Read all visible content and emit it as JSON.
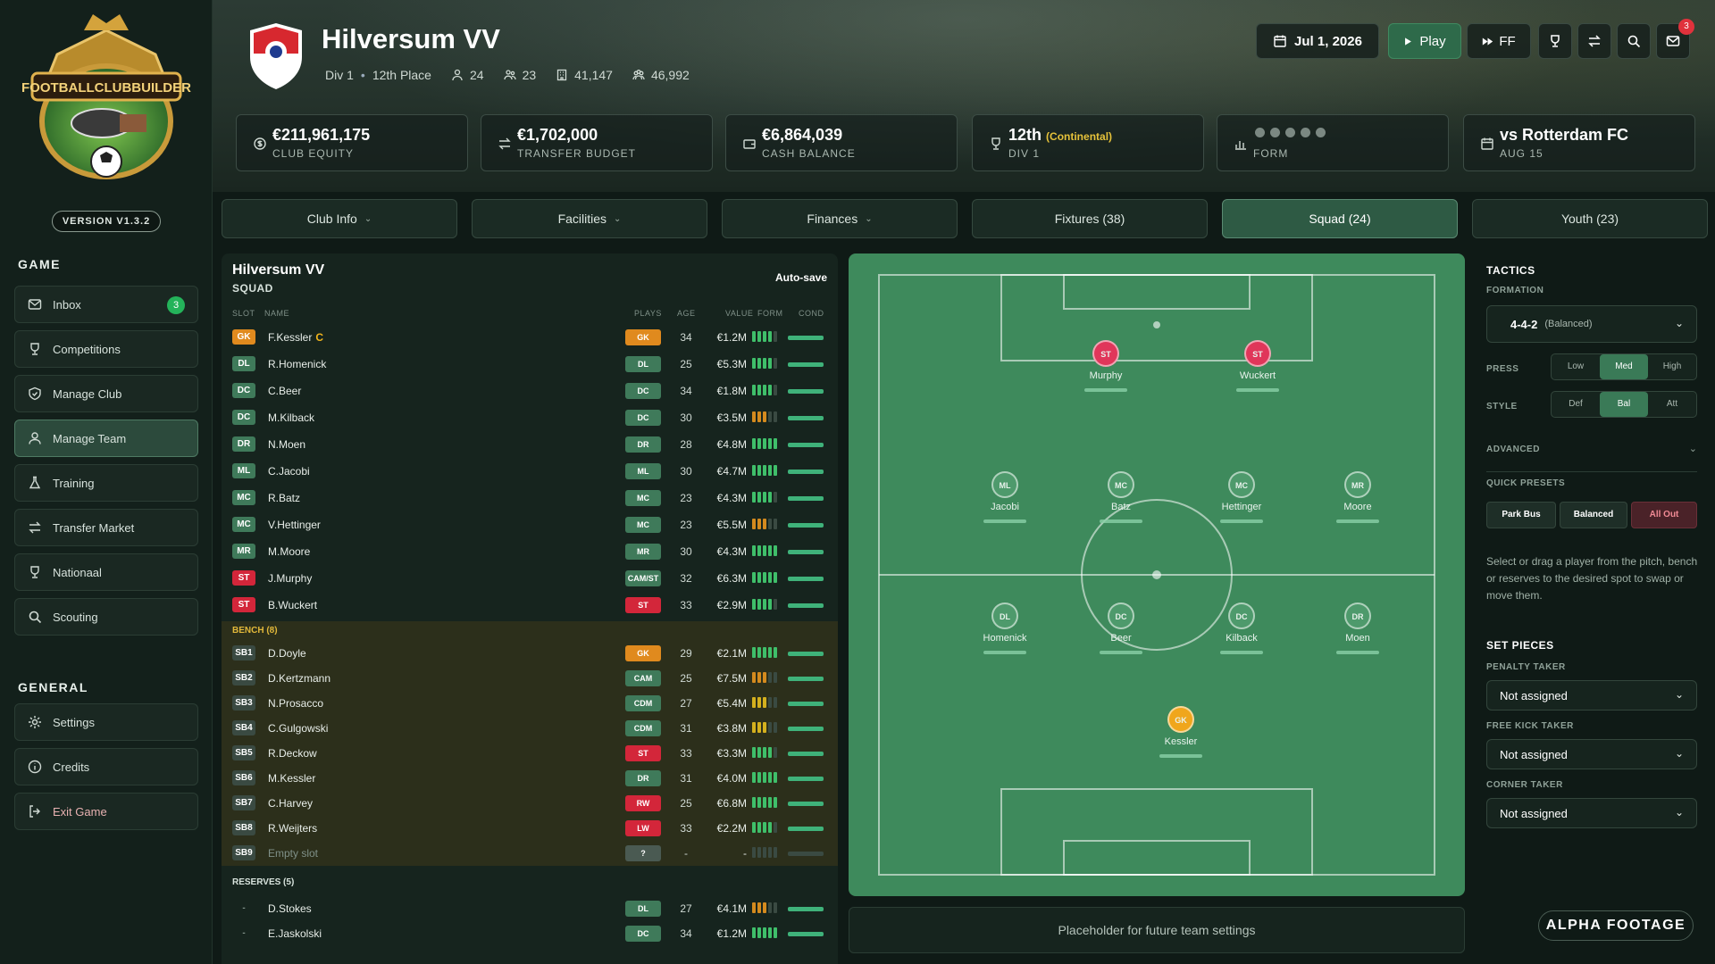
{
  "app": {
    "version": "VERSION V1.3.2",
    "logo_text": "FOOTBALLCLUBBUILDER"
  },
  "sidebar": {
    "game_title": "GAME",
    "general_title": "GENERAL",
    "game_items": [
      {
        "label": "Inbox",
        "icon": "mail-icon",
        "badge": "3"
      },
      {
        "label": "Competitions",
        "icon": "trophy-icon"
      },
      {
        "label": "Manage Club",
        "icon": "shield-icon"
      },
      {
        "label": "Manage Team",
        "icon": "user-icon",
        "active": true
      },
      {
        "label": "Training",
        "icon": "flask-icon"
      },
      {
        "label": "Transfer Market",
        "icon": "swap-icon"
      },
      {
        "label": "Nationaal",
        "icon": "trophy-icon"
      },
      {
        "label": "Scouting",
        "icon": "search-icon"
      }
    ],
    "general_items": [
      {
        "label": "Settings",
        "icon": "gear-icon"
      },
      {
        "label": "Credits",
        "icon": "info-icon"
      },
      {
        "label": "Exit Game",
        "icon": "exit-icon"
      }
    ]
  },
  "header": {
    "club_name": "Hilversum VV",
    "division": "Div 1",
    "place": "12th Place",
    "stat_players": "24",
    "stat_staff": "23",
    "stat_capacity": "41,147",
    "stat_fans": "46,992",
    "date": "Jul 1, 2026",
    "play_label": "Play",
    "ff_label": "FF",
    "mail_badge": "3"
  },
  "cards": [
    {
      "value": "€211,961,175",
      "label": "CLUB EQUITY",
      "icon": "coin-icon"
    },
    {
      "value": "€1,702,000",
      "label": "TRANSFER BUDGET",
      "icon": "swap-icon"
    },
    {
      "value": "€6,864,039",
      "label": "CASH BALANCE",
      "icon": "wallet-icon"
    },
    {
      "value": "12th",
      "extra": "(Continental)",
      "label": "DIV 1",
      "icon": "trophy-icon"
    },
    {
      "value": "",
      "label": "FORM",
      "icon": "chart-icon"
    },
    {
      "value": "vs Rotterdam FC",
      "label": "AUG 15",
      "icon": "calendar-icon"
    }
  ],
  "tabs": [
    {
      "label": "Club Info",
      "dropdown": true
    },
    {
      "label": "Facilities",
      "dropdown": true
    },
    {
      "label": "Finances",
      "dropdown": true
    },
    {
      "label": "Fixtures (38)",
      "dropdown": false
    },
    {
      "label": "Squad (24)",
      "dropdown": false,
      "active": true
    },
    {
      "label": "Youth (23)",
      "dropdown": false
    }
  ],
  "squad": {
    "title": "Hilversum VV",
    "subtitle": "SQUAD",
    "autosave": "Auto-save",
    "columns": {
      "slot": "SLOT",
      "name": "NAME",
      "plays": "PLAYS",
      "age": "AGE",
      "value": "VALUE",
      "form": "FORM",
      "cond": "COND"
    },
    "starters": [
      {
        "slot": "GK",
        "name": "F.Kessler",
        "captain": "C",
        "plays": "GK",
        "age": "34",
        "value": "€1.2M",
        "form": 4
      },
      {
        "slot": "DL",
        "name": "R.Homenick",
        "plays": "DL",
        "age": "25",
        "value": "€5.3M",
        "form": 4
      },
      {
        "slot": "DC",
        "name": "C.Beer",
        "plays": "DC",
        "age": "34",
        "value": "€1.8M",
        "form": 4
      },
      {
        "slot": "DC",
        "name": "M.Kilback",
        "plays": "DC",
        "age": "30",
        "value": "€3.5M",
        "form": 2
      },
      {
        "slot": "DR",
        "name": "N.Moen",
        "plays": "DR",
        "age": "28",
        "value": "€4.8M",
        "form": 5
      },
      {
        "slot": "ML",
        "name": "C.Jacobi",
        "plays": "ML",
        "age": "30",
        "value": "€4.7M",
        "form": 5
      },
      {
        "slot": "MC",
        "name": "R.Batz",
        "plays": "MC",
        "age": "23",
        "value": "€4.3M",
        "form": 4
      },
      {
        "slot": "MC",
        "name": "V.Hettinger",
        "plays": "MC",
        "age": "23",
        "value": "€5.5M",
        "form": 2
      },
      {
        "slot": "MR",
        "name": "M.Moore",
        "plays": "MR",
        "age": "30",
        "value": "€4.3M",
        "form": 5
      },
      {
        "slot": "ST",
        "name": "J.Murphy",
        "plays": "CAM/ST",
        "age": "32",
        "value": "€6.3M",
        "form": 5
      },
      {
        "slot": "ST",
        "name": "B.Wuckert",
        "plays": "ST",
        "age": "33",
        "value": "€2.9M",
        "form": 4
      }
    ],
    "bench_title": "BENCH (8)",
    "bench": [
      {
        "slot": "SB1",
        "name": "D.Doyle",
        "plays": "GK",
        "age": "29",
        "value": "€2.1M",
        "form": 5
      },
      {
        "slot": "SB2",
        "name": "D.Kertzmann",
        "plays": "CAM",
        "age": "25",
        "value": "€7.5M",
        "form": 2
      },
      {
        "slot": "SB3",
        "name": "N.Prosacco",
        "plays": "CDM",
        "age": "27",
        "value": "€5.4M",
        "form": 3
      },
      {
        "slot": "SB4",
        "name": "C.Gulgowski",
        "plays": "CDM",
        "age": "31",
        "value": "€3.8M",
        "form": 3
      },
      {
        "slot": "SB5",
        "name": "R.Deckow",
        "plays": "ST",
        "age": "33",
        "value": "€3.3M",
        "form": 4
      },
      {
        "slot": "SB6",
        "name": "M.Kessler",
        "plays": "DR",
        "age": "31",
        "value": "€4.0M",
        "form": 5
      },
      {
        "slot": "SB7",
        "name": "C.Harvey",
        "plays": "RW",
        "age": "25",
        "value": "€6.8M",
        "form": 5
      },
      {
        "slot": "SB8",
        "name": "R.Weijters",
        "plays": "LW",
        "age": "33",
        "value": "€2.2M",
        "form": 4
      },
      {
        "slot": "SB9",
        "name": "Empty slot",
        "plays": "?",
        "age": "-",
        "value": "-",
        "form": 0,
        "empty": true
      }
    ],
    "reserves_title": "RESERVES (5)",
    "reserves": [
      {
        "slot": "-",
        "name": "D.Stokes",
        "plays": "DL",
        "age": "27",
        "value": "€4.1M",
        "form": 2
      },
      {
        "slot": "-",
        "name": "E.Jaskolski",
        "plays": "DC",
        "age": "34",
        "value": "€1.2M",
        "form": 5
      }
    ]
  },
  "pitch": {
    "players": [
      {
        "pos": "ST",
        "name": "Murphy"
      },
      {
        "pos": "ST",
        "name": "Wuckert"
      },
      {
        "pos": "ML",
        "name": "Jacobi"
      },
      {
        "pos": "MC",
        "name": "Batz"
      },
      {
        "pos": "MC",
        "name": "Hettinger"
      },
      {
        "pos": "MR",
        "name": "Moore"
      },
      {
        "pos": "DL",
        "name": "Homenick"
      },
      {
        "pos": "DC",
        "name": "Beer"
      },
      {
        "pos": "DC",
        "name": "Kilback"
      },
      {
        "pos": "DR",
        "name": "Moen"
      },
      {
        "pos": "GK",
        "name": "Kessler"
      }
    ],
    "placeholder": "Placeholder for future team settings"
  },
  "tactics": {
    "title": "TACTICS",
    "formation_label": "FORMATION",
    "formation": "4-4-2",
    "formation_style": "(Balanced)",
    "press_label": "PRESS",
    "press_options": [
      "Low",
      "Med",
      "High"
    ],
    "press_selected": "Med",
    "style_label": "STYLE",
    "style_options": [
      "Def",
      "Bal",
      "Att"
    ],
    "style_selected": "Bal",
    "advanced_label": "ADVANCED",
    "presets_label": "QUICK PRESETS",
    "presets": [
      "Park Bus",
      "Balanced",
      "All Out"
    ],
    "help": "Select or drag a player from the pitch, bench or reserves to the desired spot to swap or move them.",
    "set_pieces": "SET PIECES",
    "penalty_label": "PENALTY TAKER",
    "freekick_label": "FREE KICK TAKER",
    "corner_label": "CORNER TAKER",
    "not_assigned": "Not assigned"
  },
  "watermark": "ALPHA FOOTAGE",
  "colors": {
    "accent": "#2e5a44",
    "gk": "#e08a1e",
    "def": "#3f7a5a",
    "mid": "#3f7a5a",
    "st": "#d3263a",
    "gold": "#f0b41c"
  }
}
